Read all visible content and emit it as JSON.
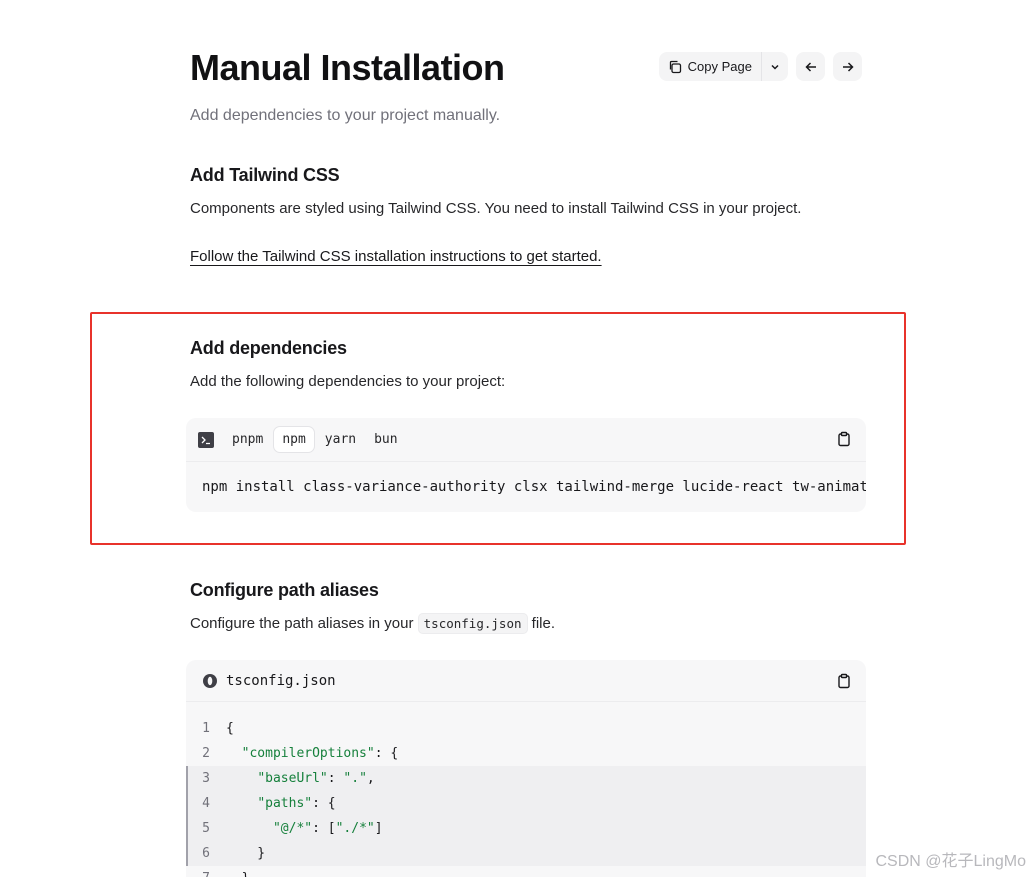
{
  "header": {
    "title": "Manual Installation",
    "copy_label": "Copy Page"
  },
  "subtitle": "Add dependencies to your project manually.",
  "tailwind": {
    "heading": "Add Tailwind CSS",
    "text": "Components are styled using Tailwind CSS. You need to install Tailwind CSS in your project.",
    "link": "Follow the Tailwind CSS installation instructions to get started."
  },
  "deps": {
    "heading": "Add dependencies",
    "text": "Add the following dependencies to your project:",
    "tabs": [
      "pnpm",
      "npm",
      "yarn",
      "bun"
    ],
    "active_tab": "npm",
    "command": "npm install class-variance-authority clsx tailwind-merge lucide-react tw-animate-css"
  },
  "aliases": {
    "heading": "Configure path aliases",
    "text_before": "Configure the path aliases in your",
    "inline_code": "tsconfig.json",
    "text_after": "file.",
    "file_name": "tsconfig.json",
    "lines": [
      {
        "n": "1",
        "text": "{"
      },
      {
        "n": "2",
        "text": "  \"compilerOptions\": {"
      },
      {
        "n": "3",
        "text": "    \"baseUrl\": \".\","
      },
      {
        "n": "4",
        "text": "    \"paths\": {"
      },
      {
        "n": "5",
        "text": "      \"@/*\": [\"./*\"]"
      },
      {
        "n": "6",
        "text": "    }"
      },
      {
        "n": "7",
        "text": "  }"
      }
    ]
  },
  "watermark": "CSDN @花子LingMo",
  "colors": {
    "highlight_border": "#e8322b",
    "string": "#16803c"
  }
}
